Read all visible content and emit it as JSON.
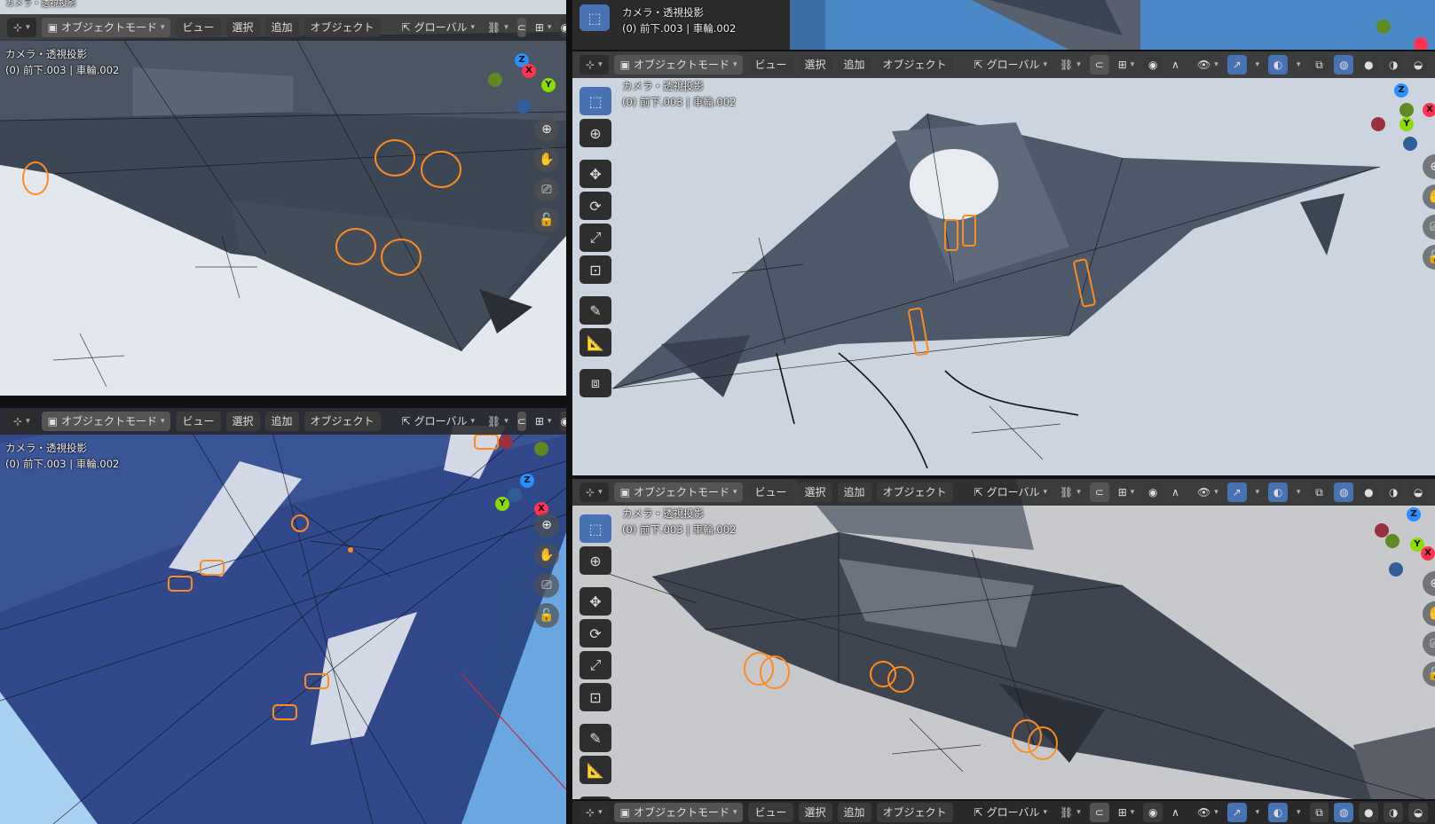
{
  "viewport_header": {
    "editor_icon": "⊹",
    "mode": "オブジェクトモード",
    "menus": [
      "ビュー",
      "選択",
      "追加",
      "オブジェクト"
    ],
    "transform": "グローバル"
  },
  "overlay": {
    "camera": "カメラ・透視投影",
    "object": "(0) 前下.003 | 車輪.002"
  },
  "gizmo": {
    "x": "X",
    "y": "Y",
    "z": "Z"
  },
  "icons": {
    "transform_orientation": "transform-icon",
    "snap": "magnet-icon",
    "pivot": "link-icon",
    "proportional": "proportional-icon",
    "select_box": "select-box-icon",
    "cursor": "cursor-icon",
    "move": "move-icon",
    "rotate": "rotate-icon",
    "scale": "scale-icon",
    "transform_tool": "transform-tool-icon",
    "annotate": "annotate-icon",
    "measure": "measure-icon",
    "add_cube": "add-cube-icon",
    "zoom": "zoom-icon",
    "pan": "hand-icon",
    "camera": "camera-icon",
    "lock": "lock-icon"
  },
  "colors": {
    "accent": "#4772b3",
    "header": "#2b2b2b",
    "wire_select": "#ff8a1f"
  }
}
